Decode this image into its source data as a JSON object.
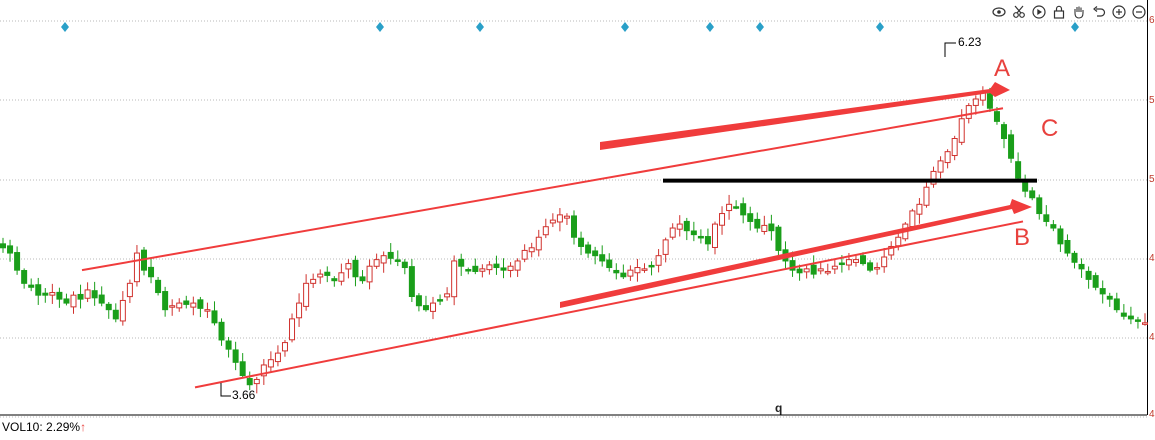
{
  "toolbar": {
    "icons": [
      "eye-icon",
      "scissors-icon",
      "play-circle-icon",
      "lock-icon",
      "hand-icon",
      "undo-icon",
      "zoom-in-icon",
      "zoom-out-icon"
    ]
  },
  "price_axis": {
    "tick_labels": [
      "6",
      "5",
      "5",
      "4",
      "4",
      "4"
    ]
  },
  "annotations": {
    "label_a": "A",
    "label_b": "B",
    "label_c": "C",
    "peak_label": "6.23",
    "trough_label": "3.66"
  },
  "indicator": {
    "prefix": "VOL10: ",
    "value": "2.29%",
    "arrow": "↑"
  },
  "footer_mark": "q",
  "colors": {
    "up": "#d0312d",
    "down": "#1a9e1a",
    "channel": "#f03c3c",
    "resistance": "#000000",
    "marker": "#2aa0c8",
    "grid": "#b8b8b8"
  },
  "chart_data": {
    "type": "candlestick",
    "ylim": [
      3.45,
      6.45
    ],
    "ticks": [
      6,
      5.5,
      5,
      4.5,
      4,
      3.5
    ],
    "grid": "horizontal dotted",
    "peak": 6.23,
    "trough": 3.66,
    "close_path": [
      4.72,
      4.68,
      4.55,
      4.45,
      4.42,
      4.36,
      4.36,
      4.38,
      4.33,
      4.3,
      4.36,
      4.33,
      4.4,
      4.34,
      4.3,
      4.25,
      4.18,
      4.32,
      4.45,
      4.68,
      4.55,
      4.5,
      4.38,
      4.25,
      4.28,
      4.3,
      4.29,
      4.3,
      4.26,
      4.25,
      4.15,
      4.02,
      3.95,
      3.85,
      3.75,
      3.68,
      3.72,
      3.83,
      3.87,
      3.92,
      4.0,
      4.18,
      4.3,
      4.45,
      4.48,
      4.52,
      4.51,
      4.47,
      4.53,
      4.6,
      4.5,
      4.47,
      4.58,
      4.63,
      4.66,
      4.64,
      4.62,
      4.57,
      4.35,
      4.28,
      4.25,
      4.3,
      4.32,
      4.37,
      4.62,
      4.58,
      4.55,
      4.54,
      4.56,
      4.59,
      4.57,
      4.55,
      4.58,
      4.62,
      4.7,
      4.72,
      4.8,
      4.88,
      4.93,
      4.97,
      4.96,
      4.8,
      4.73,
      4.68,
      4.66,
      4.62,
      4.57,
      4.53,
      4.5,
      4.55,
      4.57,
      4.56,
      4.58,
      4.66,
      4.78,
      4.87,
      4.9,
      4.85,
      4.82,
      4.8,
      4.75,
      4.9,
      4.98,
      5.05,
      5.03,
      4.97,
      4.92,
      4.87,
      4.89,
      4.85,
      4.7,
      4.62,
      4.55,
      4.53,
      4.56,
      4.52,
      4.56,
      4.54,
      4.58,
      4.6,
      4.63,
      4.63,
      4.6,
      4.55,
      4.57,
      4.65,
      4.73,
      4.8,
      4.9,
      5.0,
      5.05,
      5.18,
      5.3,
      5.38,
      5.45,
      5.55,
      5.7,
      5.8,
      5.85,
      5.9,
      5.78,
      5.68,
      5.55,
      5.4,
      5.25,
      5.15,
      5.1,
      4.98,
      4.92,
      4.87,
      4.75,
      4.68,
      4.61,
      4.56,
      4.48,
      4.42,
      4.37,
      4.33,
      4.25,
      4.2,
      4.18,
      4.17,
      4.15
    ],
    "channel_upper": {
      "from": 4.55,
      "to": 5.78
    },
    "channel_lower": {
      "from": 3.66,
      "to": 4.92
    },
    "resistance_level": 5.23,
    "event_markers": 9
  }
}
